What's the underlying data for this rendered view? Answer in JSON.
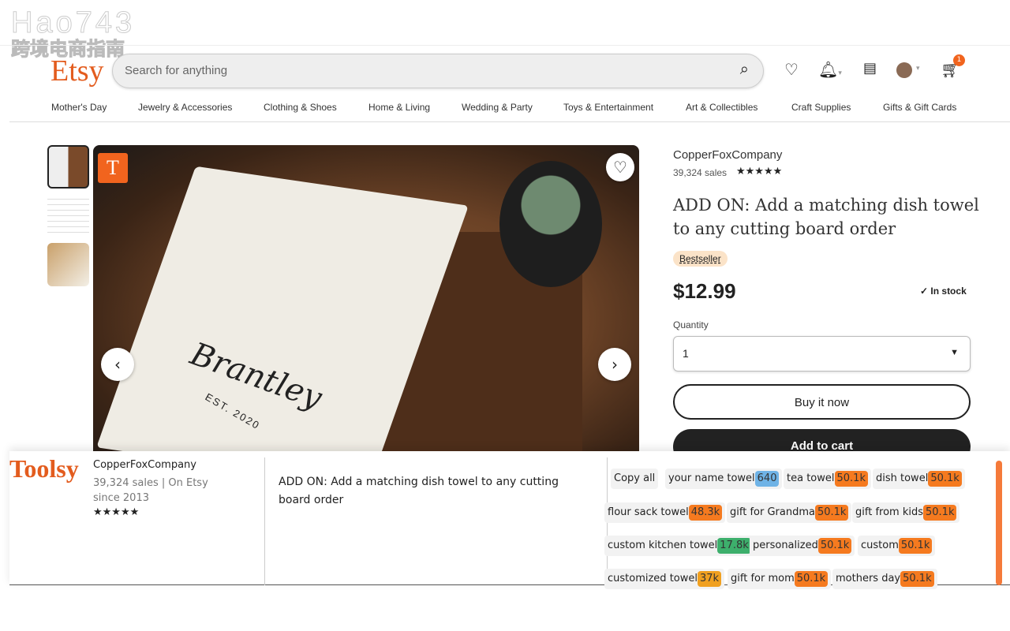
{
  "watermark": {
    "line1": "Hao743",
    "line2": "跨境电商指南"
  },
  "header": {
    "logo": "Etsy",
    "search_placeholder": "Search for anything",
    "cart_count": "1"
  },
  "nav": [
    "Mother's Day",
    "Jewelry & Accessories",
    "Clothing & Shoes",
    "Home & Living",
    "Wedding & Party",
    "Toys & Entertainment",
    "Art & Collectibles",
    "Craft Supplies",
    "Gifts & Gift Cards"
  ],
  "product": {
    "shop": "CopperFoxCompany",
    "sales": "39,324 sales",
    "stars": "★★★★★",
    "title": "ADD ON: Add a matching dish towel to any cutting board order",
    "badge": "Bestseller",
    "price": "$12.99",
    "stock": "In stock",
    "quantity_label": "Quantity",
    "quantity_value": "1",
    "buy_now": "Buy it now",
    "add_to_cart": "Add to cart",
    "image_badge": "T",
    "image_text": "Brantley",
    "image_subtext": "EST. 2020"
  },
  "toolsy": {
    "logo": "Toolsy",
    "shop": "CopperFoxCompany",
    "meta": "39,324 sales | On Etsy since 2013",
    "stars": "★★★★★",
    "title": "ADD ON: Add a matching dish towel to any cutting board order",
    "copy_all": "Copy all",
    "tags": [
      {
        "label": "your name towel",
        "count": "640",
        "color": "#6fb3e6"
      },
      {
        "label": "tea towel",
        "count": "50.1k",
        "color": "#f57a1f"
      },
      {
        "label": "dish towel",
        "count": "50.1k",
        "color": "#f57a1f"
      },
      {
        "label": "flour sack towel",
        "count": "48.3k",
        "color": "#f57a1f"
      },
      {
        "label": "gift for Grandma",
        "count": "50.1k",
        "color": "#f57a1f"
      },
      {
        "label": "gift from kids",
        "count": "50.1k",
        "color": "#f57a1f"
      },
      {
        "label": "custom kitchen towel",
        "count": "17.8k",
        "color": "#3daf6c"
      },
      {
        "label": "personalized",
        "count": "50.1k",
        "color": "#f57a1f"
      },
      {
        "label": "custom",
        "count": "50.1k",
        "color": "#f57a1f"
      },
      {
        "label": "customized towel",
        "count": "37k",
        "color": "#f0a020"
      },
      {
        "label": "gift for mom",
        "count": "50.1k",
        "color": "#f57a1f"
      },
      {
        "label": "mothers day",
        "count": "50.1k",
        "color": "#f57a1f"
      }
    ]
  }
}
